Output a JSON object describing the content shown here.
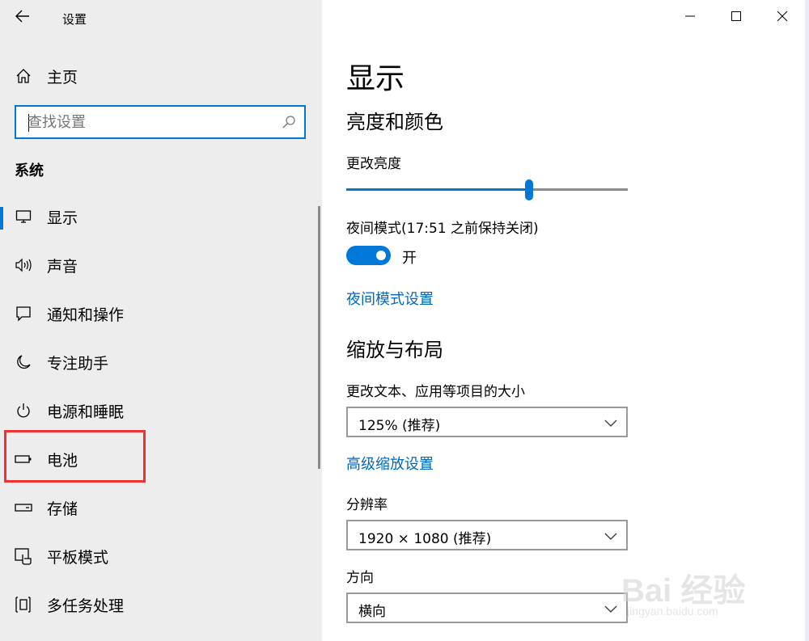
{
  "window": {
    "title": "设置"
  },
  "sidebar": {
    "home_label": "主页",
    "search_placeholder": "查找设置",
    "section_title": "系统",
    "items": [
      {
        "label": "显示",
        "icon": "monitor-icon",
        "selected": true
      },
      {
        "label": "声音",
        "icon": "speaker-icon",
        "selected": false
      },
      {
        "label": "通知和操作",
        "icon": "notification-icon",
        "selected": false
      },
      {
        "label": "专注助手",
        "icon": "moon-icon",
        "selected": false
      },
      {
        "label": "电源和睡眠",
        "icon": "power-icon",
        "selected": false
      },
      {
        "label": "电池",
        "icon": "battery-icon",
        "selected": false
      },
      {
        "label": "存储",
        "icon": "storage-icon",
        "selected": false
      },
      {
        "label": "平板模式",
        "icon": "tablet-mode-icon",
        "selected": false
      },
      {
        "label": "多任务处理",
        "icon": "multitasking-icon",
        "selected": false
      }
    ]
  },
  "main": {
    "page_title": "显示",
    "brightness": {
      "heading": "亮度和颜色",
      "label": "更改亮度",
      "value_fraction": 0.65
    },
    "night_light": {
      "label": "夜间模式(17:51 之前保持关闭)",
      "toggle_state": "开",
      "link": "夜间模式设置"
    },
    "scale": {
      "heading": "缩放与布局",
      "label": "更改文本、应用等项目的大小",
      "value": "125% (推荐)",
      "link": "高级缩放设置"
    },
    "resolution": {
      "label": "分辨率",
      "value": "1920 × 1080 (推荐)"
    },
    "orientation": {
      "label": "方向",
      "value": "横向"
    }
  },
  "watermark": {
    "brand": "Bai 经验",
    "url": "jingyan.baidu.com"
  },
  "colors": {
    "accent": "#0078d7",
    "link": "#0067c0",
    "highlight": "#ee3333"
  }
}
